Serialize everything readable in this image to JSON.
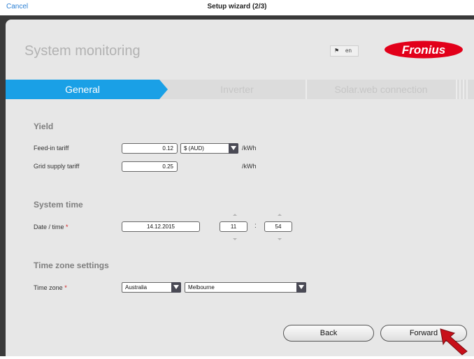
{
  "topbar": {
    "cancel_label": "Cancel",
    "title": "Setup wizard (2/3)"
  },
  "app": {
    "title": "System monitoring",
    "language": "en",
    "brand": "Fronius"
  },
  "tabs": [
    {
      "label": "General",
      "active": true
    },
    {
      "label": "Inverter",
      "active": false
    },
    {
      "label": "Solar.web connection",
      "active": false
    }
  ],
  "yield": {
    "title": "Yield",
    "feed_in_label": "Feed-in tariff",
    "feed_in_value": "0.12",
    "currency": "$ (AUD)",
    "feed_in_unit": "/kWh",
    "grid_label": "Grid supply tariff",
    "grid_value": "0.25",
    "grid_unit": "/kWh"
  },
  "system_time": {
    "title": "System time",
    "label": "Date / time",
    "required_mark": "*",
    "date": "14.12.2015",
    "hour": "11",
    "separator": ":",
    "minute": "54"
  },
  "timezone": {
    "title": "Time zone settings",
    "label": "Time zone",
    "required_mark": "*",
    "region": "Australia",
    "city": "Melbourne"
  },
  "buttons": {
    "back": "Back",
    "forward": "Forward"
  },
  "colors": {
    "accent": "#1aa0e6",
    "brand_red": "#e2001a",
    "required": "#d21e1e"
  }
}
